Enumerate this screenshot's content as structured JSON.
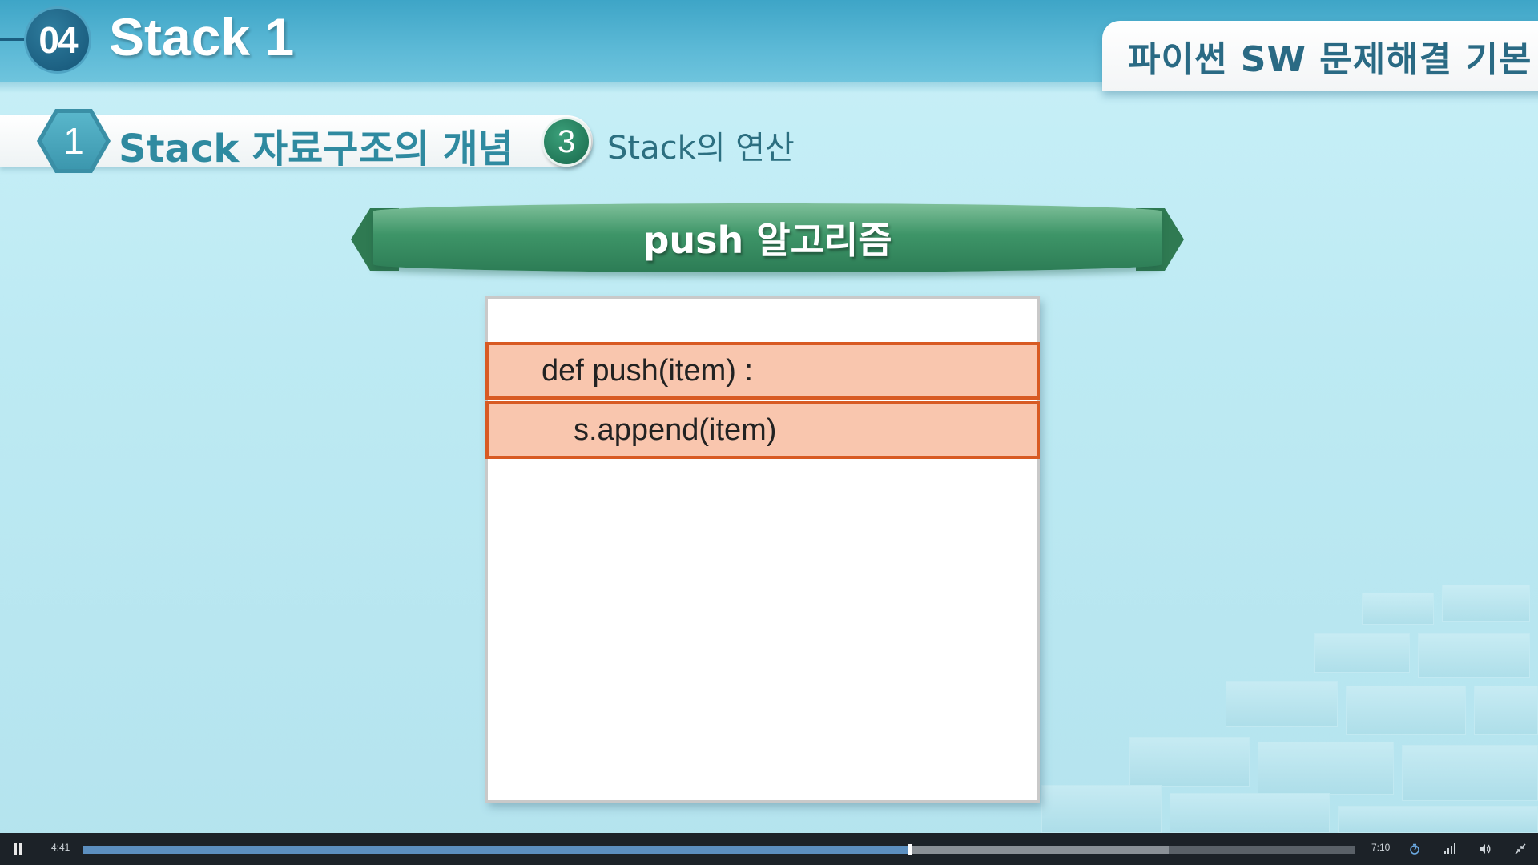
{
  "header": {
    "chapter_number": "04",
    "chapter_title": "Stack 1",
    "course_title": "파이썬 SW 문제해결 기본"
  },
  "section": {
    "number": "1",
    "title": "Stack 자료구조의 개념",
    "sub_number": "3",
    "sub_title": "Stack의 연산"
  },
  "banner": {
    "title": "push 알고리즘"
  },
  "code": {
    "lines": [
      "def push(item) :",
      "s.append(item)"
    ],
    "highlight_fill": "#f9c6ae",
    "highlight_border": "#d85a23"
  },
  "player": {
    "current_time": "4:41",
    "duration": "7:10",
    "played_fraction": 0.65,
    "buffered_fraction": 0.853,
    "icons": [
      "pause-icon",
      "speed-icon",
      "quality-icon",
      "volume-icon",
      "exit-fullscreen-icon"
    ],
    "accent_color": "#5c8fc0"
  }
}
